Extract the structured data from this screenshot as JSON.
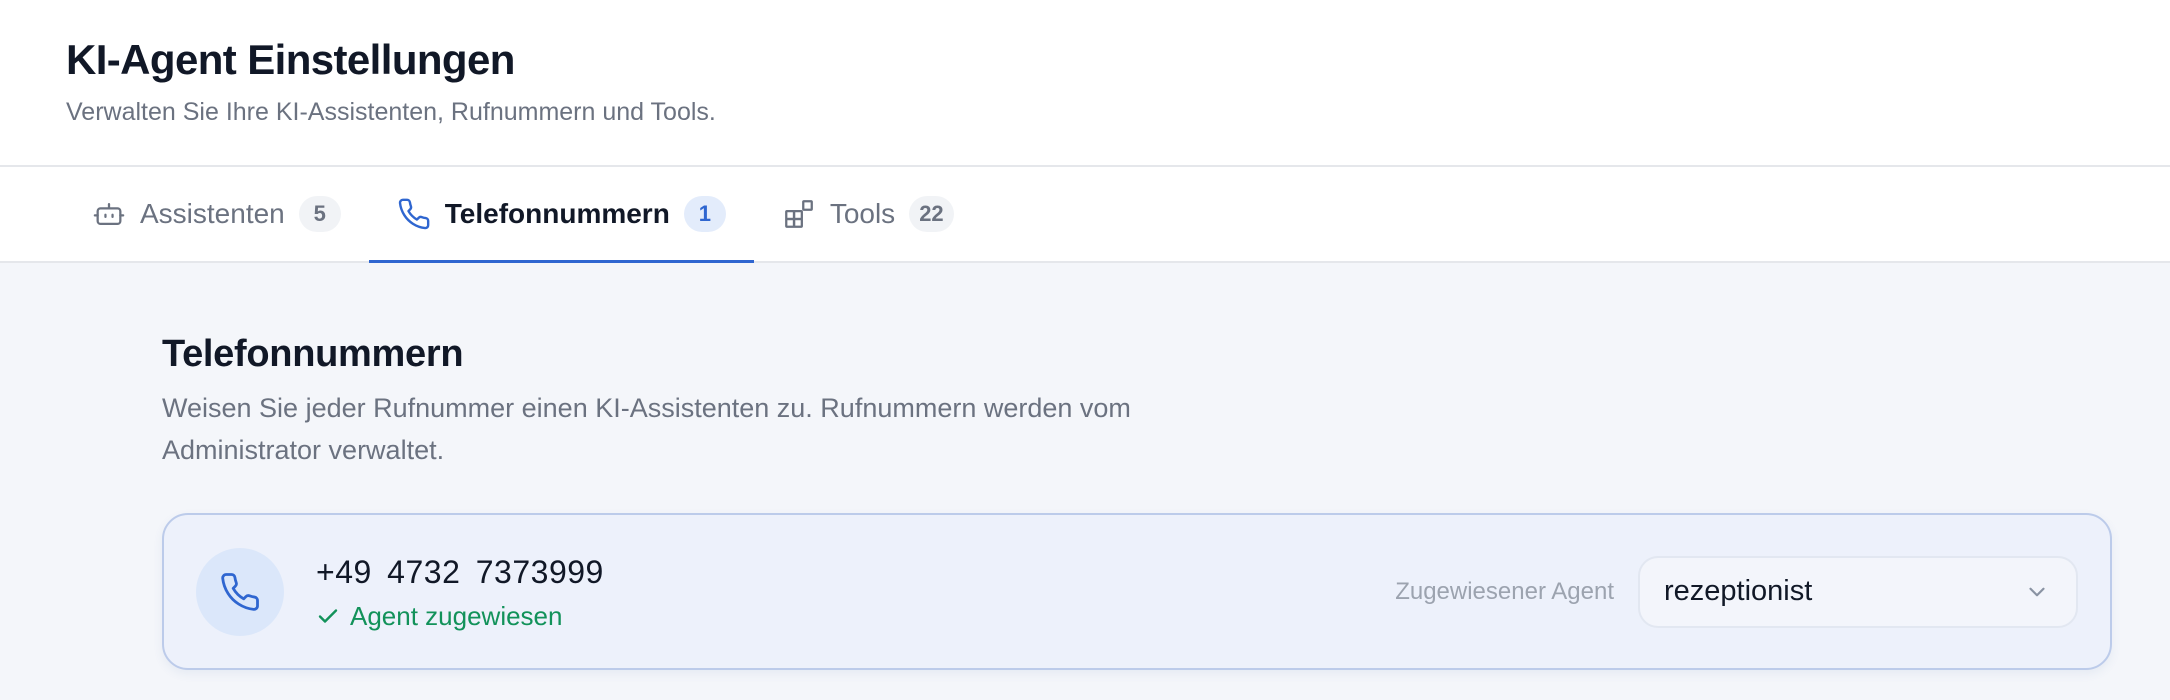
{
  "header": {
    "title": "KI-Agent Einstellungen",
    "subtitle": "Verwalten Sie Ihre KI-Assistenten, Rufnummern und Tools."
  },
  "tabs": [
    {
      "label": "Assistenten",
      "count": "5",
      "icon": "robot-icon",
      "active": false
    },
    {
      "label": "Telefonnummern",
      "count": "1",
      "icon": "phone-icon",
      "active": true
    },
    {
      "label": "Tools",
      "count": "22",
      "icon": "grid-icon",
      "active": false
    }
  ],
  "section": {
    "title": "Telefonnummern",
    "description": "Weisen Sie jeder Rufnummer einen KI-Assistenten zu. Rufnummern werden vom Administrator verwaltet."
  },
  "phone_entry": {
    "number": "+49 4732 7373999",
    "status": "Agent zugewiesen",
    "assign_label": "Zugewiesener Agent",
    "selected_agent": "rezeptionist"
  },
  "colors": {
    "accent": "#2f66d0",
    "success": "#12925a",
    "muted_text": "#6b7280",
    "card_background": "#edf1fb",
    "card_border": "#bccbea"
  }
}
